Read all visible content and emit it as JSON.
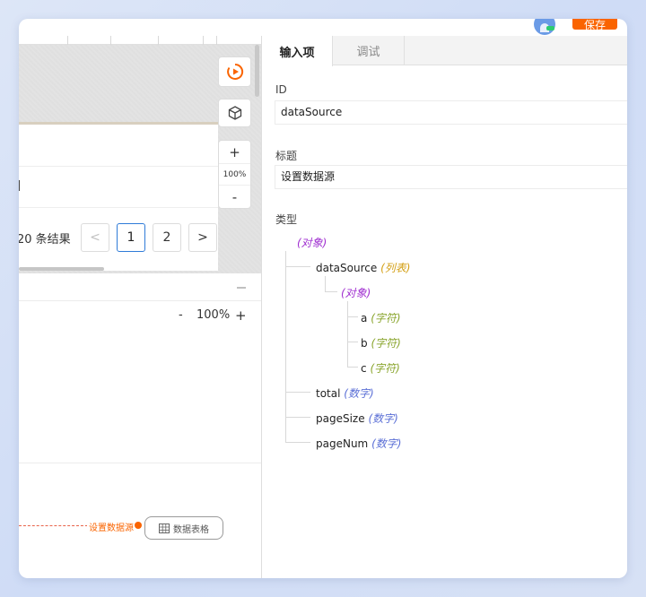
{
  "header": {
    "save_label": "保存"
  },
  "canvas": {
    "zoom_value": "100%",
    "zoom_plus": "+",
    "zoom_minus": "-",
    "pager": {
      "summary": "20 条结果",
      "prev": "<",
      "pages": [
        "1",
        "2"
      ],
      "next": ">",
      "current": "1"
    }
  },
  "logic": {
    "zoom_minus": "-",
    "zoom_value": "100%",
    "zoom_plus": "+",
    "edge_label": "设置数据源",
    "node_label": "数据表格"
  },
  "panel": {
    "tabs": [
      {
        "label": "输入项",
        "active": true
      },
      {
        "label": "调试",
        "active": false
      }
    ],
    "id_label": "ID",
    "id_value": "dataSource",
    "title_label": "标题",
    "title_value": "设置数据源",
    "type_label": "类型",
    "type_tree": {
      "root_type": "(对象)",
      "datasource_key": "dataSource",
      "datasource_type": "(列表)",
      "item_type": "(对象)",
      "a_key": "a",
      "a_type": "(字符)",
      "b_key": "b",
      "b_type": "(字符)",
      "c_key": "c",
      "c_type": "(字符)",
      "total_key": "total",
      "total_type": "(数字)",
      "pagesize_key": "pageSize",
      "pagesize_type": "(数字)",
      "pagenum_key": "pageNum",
      "pagenum_type": "(数字)"
    }
  },
  "colors": {
    "accent": "#fa6400",
    "object_type": "#a030d0",
    "list_type": "#d4a017",
    "string_type": "#8aa52e",
    "number_type": "#5b6fd6",
    "active_page_border": "#2f7bd8"
  },
  "icons": [
    "play-circle-icon",
    "cube-icon",
    "table-icon",
    "avatar-icon"
  ]
}
